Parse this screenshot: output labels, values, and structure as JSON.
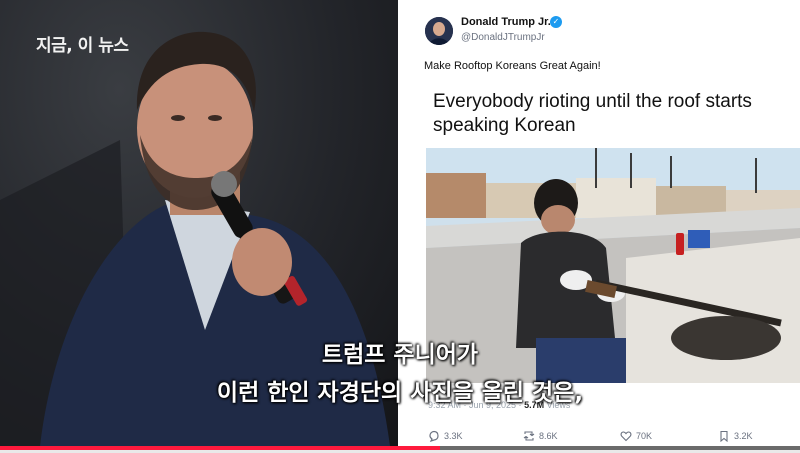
{
  "video": {
    "channel_watermark": "지금, 이 뉴스",
    "subtitle_line1": "트럼프 주니어가",
    "subtitle_line2": "이런 한인 자경단의 사진을 올린 것은,",
    "progress_fraction": 0.55,
    "progress_color": "#ff1a3d"
  },
  "tweet": {
    "author_name": "Donald Trump Jr.",
    "verified_icon": "✓",
    "handle": "@DonaldJTrumpJr",
    "text": "Make Rooftop Koreans Great Again!",
    "meme_caption": "Everyobody rioting until the roof starts speaking Korean",
    "timestamp": "9:32 AM · Jun 9, 2025 · ",
    "views_count": "5.7M",
    "views_label": " Views",
    "actions": [
      {
        "icon": "reply-icon",
        "count": "3.3K"
      },
      {
        "icon": "repost-icon",
        "count": "8.6K"
      },
      {
        "icon": "like-icon",
        "count": "70K"
      },
      {
        "icon": "bookmark-icon",
        "count": "3.2K"
      }
    ]
  }
}
